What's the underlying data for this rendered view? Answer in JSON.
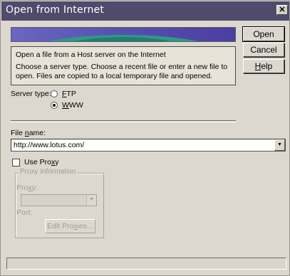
{
  "dialog": {
    "title": "Open from Internet",
    "close_glyph": "✕"
  },
  "buttons": {
    "open": "Open",
    "cancel": "Cancel",
    "help_prefix": "",
    "help_mnemonic": "H",
    "help_rest": "elp"
  },
  "info": {
    "line1": "Open a file from a Host server on the Internet",
    "line2": "Choose a server type. Choose a recent file or enter a new file to open. Files are copied to a local temporary file and opened."
  },
  "server_type": {
    "label": "Server type:",
    "options": [
      {
        "mnemonic": "F",
        "rest": "TP",
        "selected": false
      },
      {
        "mnemonic": "W",
        "rest": "WW",
        "selected": true
      }
    ]
  },
  "file_name": {
    "label_prefix": "File ",
    "label_mnemonic": "n",
    "label_rest": "ame:",
    "value": "http://www.lotus.com/",
    "arrow_glyph": "▼"
  },
  "use_proxy": {
    "label_prefix": "Use Pro",
    "label_mnemonic": "x",
    "label_rest": "y",
    "checked": false
  },
  "proxy_group": {
    "label": "Proxy Information",
    "proxy_label_prefix": "Pro",
    "proxy_label_mnemonic": "x",
    "proxy_label_rest": "y:",
    "arrow_glyph": "▼",
    "port_label": "Port:",
    "edit_prefix": "Edit Pro",
    "edit_mnemonic": "x",
    "edit_rest": "ies..."
  },
  "status_bar": {
    "text": ""
  },
  "colors": {
    "titlebar": "#4e4b6d",
    "dialog_bg": "#dcd8cf",
    "banner_left": "#6b66c2",
    "banner_arc": "#2f9a86"
  },
  "icons": {
    "close": "close-icon",
    "dropdown": "chevron-down-icon"
  }
}
